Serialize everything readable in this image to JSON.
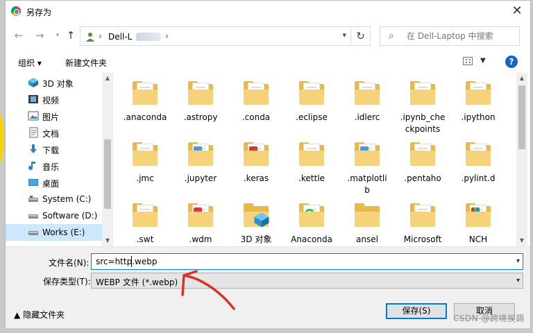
{
  "window": {
    "title": "另存为"
  },
  "address": {
    "path": "Dell-L",
    "search_placeholder": "在 Dell-Laptop 中搜索"
  },
  "toolbar": {
    "organize": "组织 ▾",
    "new_folder": "新建文件夹"
  },
  "sidebar": {
    "items": [
      {
        "label": "3D 对象",
        "icon": "3d-objects-icon"
      },
      {
        "label": "视频",
        "icon": "video-icon"
      },
      {
        "label": "图片",
        "icon": "picture-icon"
      },
      {
        "label": "文档",
        "icon": "document-icon"
      },
      {
        "label": "下载",
        "icon": "download-icon"
      },
      {
        "label": "音乐",
        "icon": "music-icon"
      },
      {
        "label": "桌面",
        "icon": "desktop-icon"
      },
      {
        "label": "System (C:)",
        "icon": "drive-icon"
      },
      {
        "label": "Software (D:)",
        "icon": "drive-icon"
      },
      {
        "label": "Works (E:)",
        "icon": "drive-icon",
        "selected": true
      }
    ]
  },
  "files": [
    ".anaconda",
    ".astropy",
    ".conda",
    ".eclipse",
    ".idlerc",
    ".ipynb_checkpoints",
    ".ipython",
    ".jmc",
    ".jupyter",
    ".keras",
    ".kettle",
    ".matplotlib",
    ".pentaho",
    ".pylint.d",
    ".swt",
    ".wdm",
    "3D 对象",
    "Anaconda",
    "ansel",
    "Microsoft",
    "NCH"
  ],
  "file_display": {
    "ipynb_line1": ".ipynb_che",
    "ipynb_line2": "ckpoints",
    "matplot_line1": ".matplotli",
    "matplot_line2": "b"
  },
  "form": {
    "filename_label": "文件名(N):",
    "filename_value": "src=http.webp",
    "filetype_label": "保存类型(T):",
    "filetype_value": "WEBP 文件 (*.webp)"
  },
  "footer": {
    "hide_folders": "隐藏文件夹",
    "save_button": "保存(S)",
    "cancel_button": "取消",
    "watermark": "CSDN @跨境挨踢"
  },
  "colors": {
    "accent": "#0078d7",
    "folder": "#f6d37a",
    "selected": "#cce8ff",
    "annotation": "#e0302a"
  }
}
